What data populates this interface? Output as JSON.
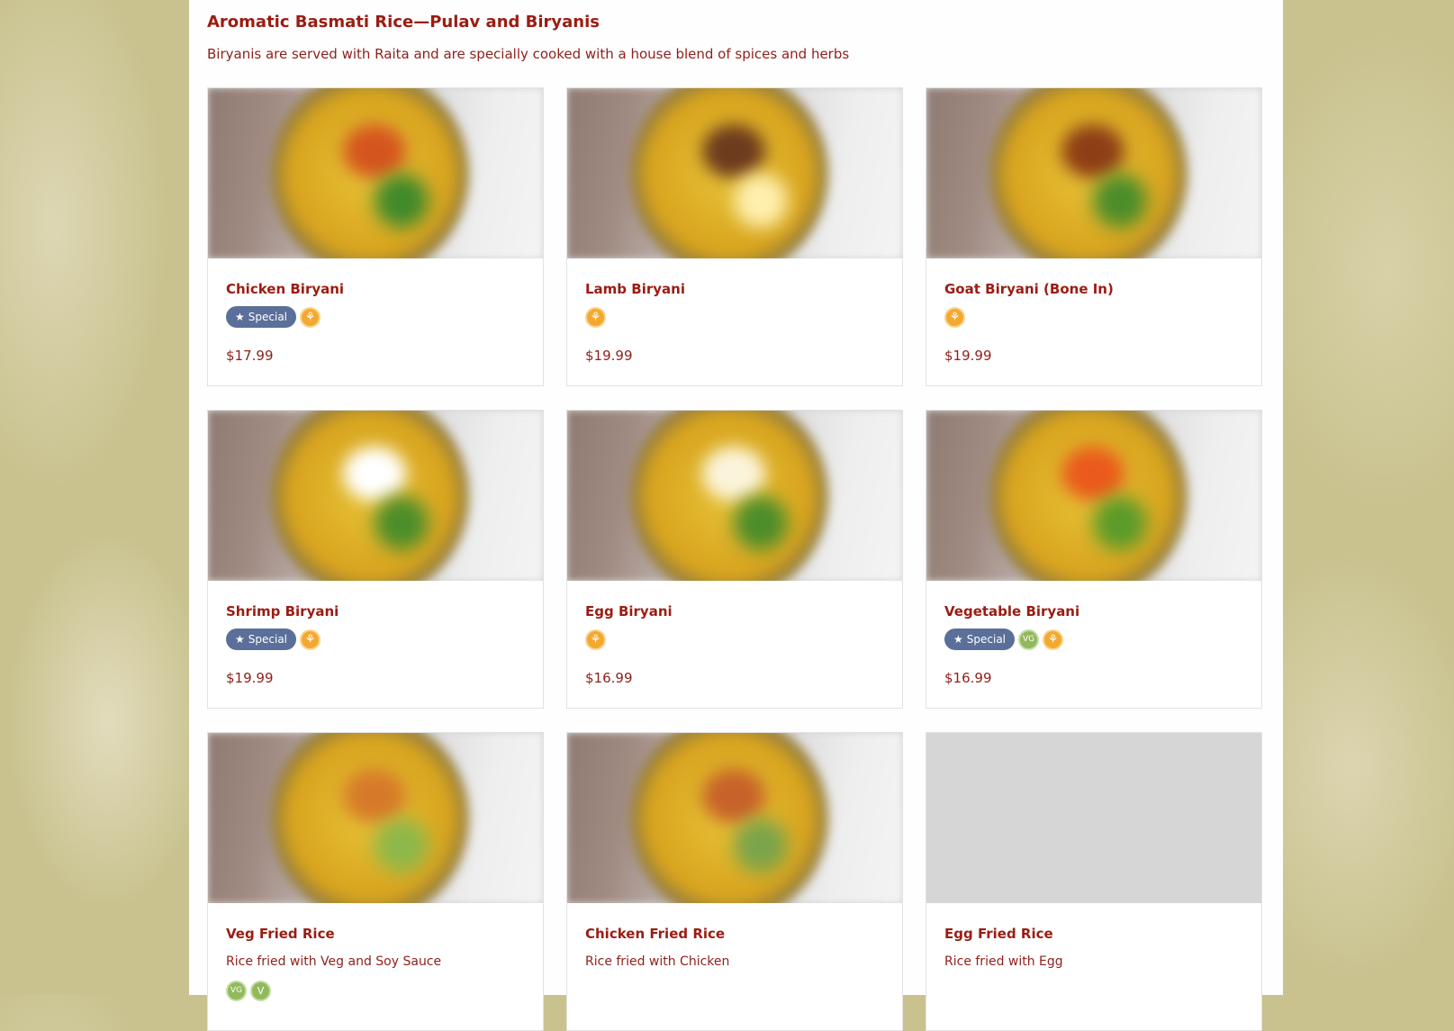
{
  "section": {
    "title": "Aromatic Basmati Rice—Pulav and Biryanis",
    "description": "Biryanis are served with Raita and are specially cooked with a house blend of spices and herbs"
  },
  "labels": {
    "special": "Special",
    "vg": "VG",
    "v": "V",
    "gf_icon": "gluten-free-icon"
  },
  "colors": {
    "accent_red": "#9b1c12",
    "special_badge": "#5a6f99",
    "gluten_free_badge": "#f3a931",
    "vegan_badge": "#91b95d"
  },
  "items": [
    {
      "name": "Chicken Biryani",
      "description": "",
      "special": true,
      "vegan": false,
      "vegetarian": false,
      "gluten_free": true,
      "price": "$17.99"
    },
    {
      "name": "Lamb Biryani",
      "description": "",
      "special": false,
      "vegan": false,
      "vegetarian": false,
      "gluten_free": true,
      "price": "$19.99"
    },
    {
      "name": "Goat Biryani (Bone In)",
      "description": "",
      "special": false,
      "vegan": false,
      "vegetarian": false,
      "gluten_free": true,
      "price": "$19.99"
    },
    {
      "name": "Shrimp Biryani",
      "description": "",
      "special": true,
      "vegan": false,
      "vegetarian": false,
      "gluten_free": true,
      "price": "$19.99"
    },
    {
      "name": "Egg Biryani",
      "description": "",
      "special": false,
      "vegan": false,
      "vegetarian": false,
      "gluten_free": true,
      "price": "$16.99"
    },
    {
      "name": "Vegetable Biryani",
      "description": "",
      "special": true,
      "vegan": true,
      "vegetarian": false,
      "gluten_free": true,
      "price": "$16.99"
    },
    {
      "name": "Veg Fried Rice",
      "description": "Rice fried with Veg and Soy Sauce",
      "special": false,
      "vegan": true,
      "vegetarian": true,
      "gluten_free": false,
      "price": ""
    },
    {
      "name": "Chicken Fried Rice",
      "description": "Rice fried with Chicken",
      "special": false,
      "vegan": false,
      "vegetarian": false,
      "gluten_free": false,
      "price": ""
    },
    {
      "name": "Egg Fried Rice",
      "description": "Rice fried with Egg",
      "special": false,
      "vegan": false,
      "vegetarian": false,
      "gluten_free": false,
      "price": "",
      "image_placeholder": true
    }
  ]
}
